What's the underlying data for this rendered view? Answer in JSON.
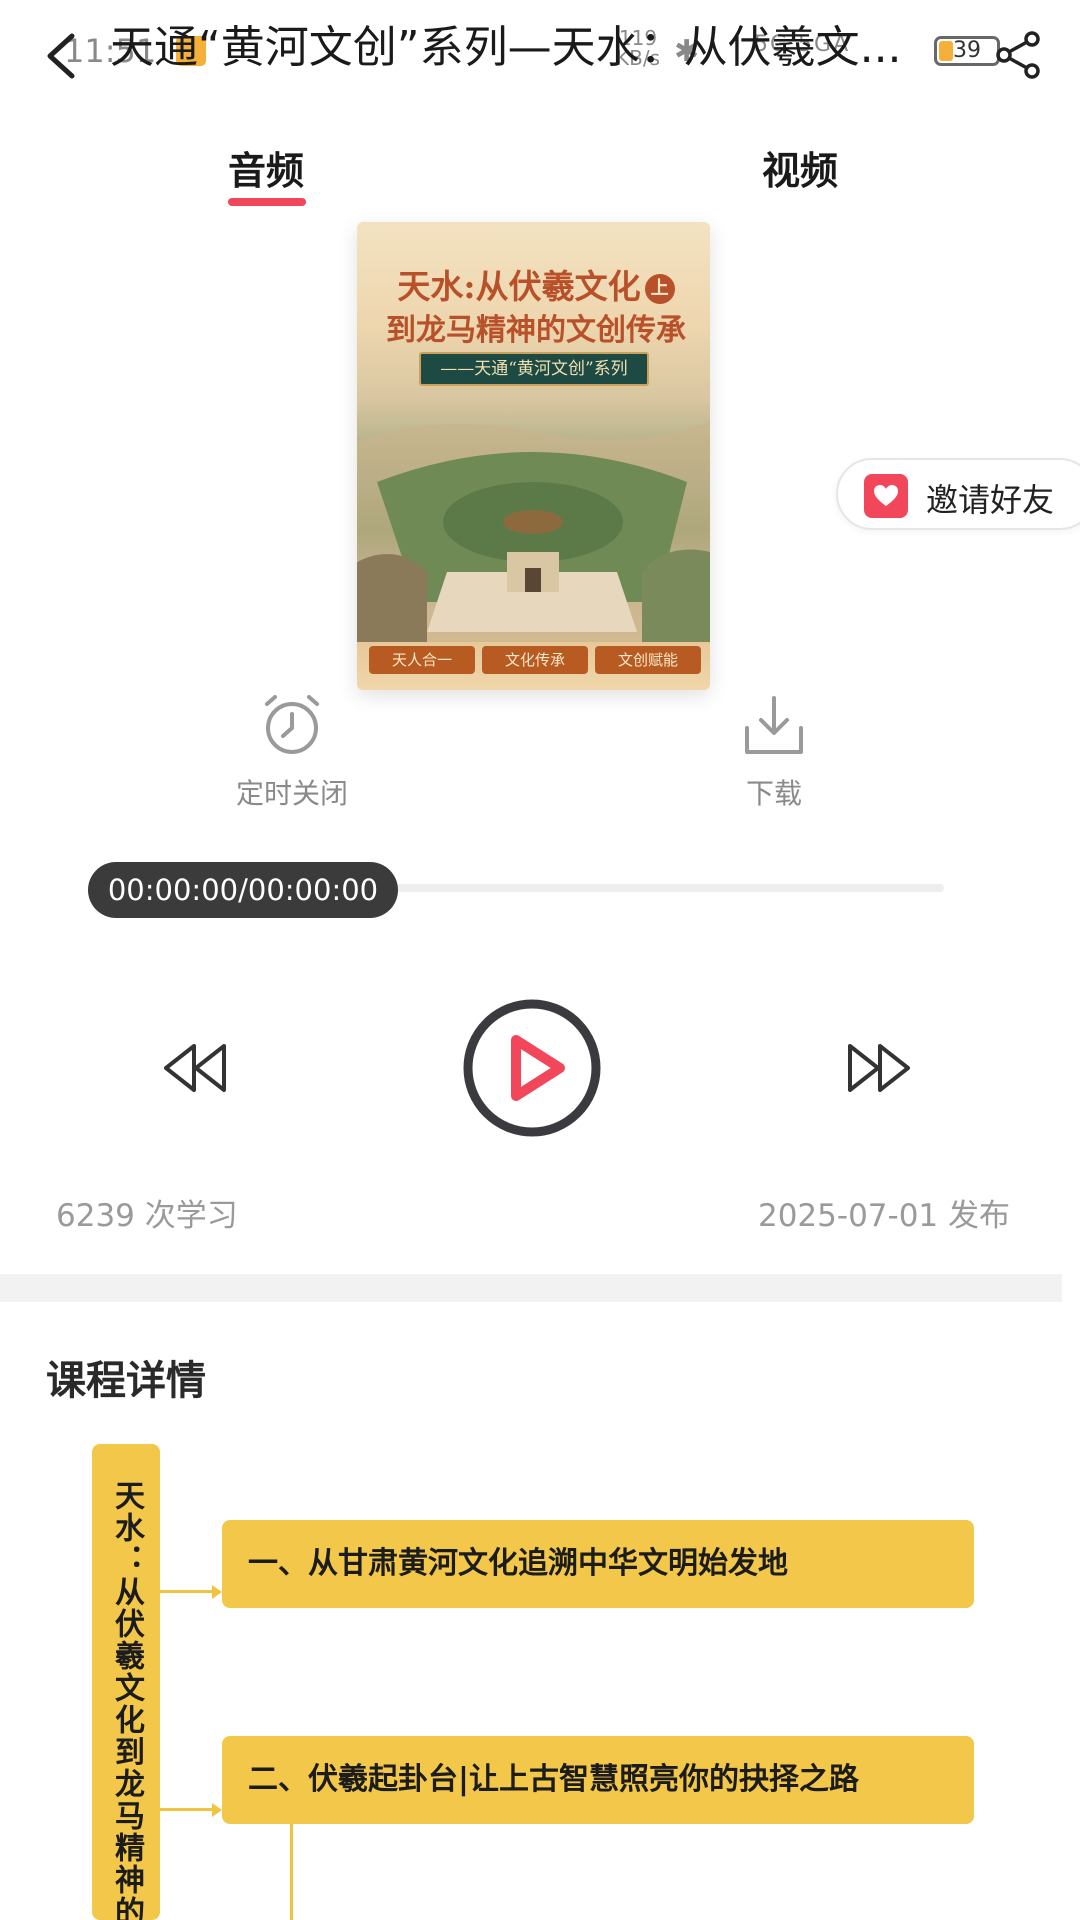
{
  "status_bar": {
    "time": "11:51",
    "net_speed": "119\nKB/s",
    "network": "5G 5GA",
    "battery": "39"
  },
  "header": {
    "title": "天通“黄河文创”系列—天水：从伏羲文..."
  },
  "tabs": [
    {
      "label": "音频",
      "active": true
    },
    {
      "label": "视频",
      "active": false
    }
  ],
  "cover": {
    "title_line1": "天水:从伏羲文化",
    "title_mark": "上",
    "title_line2": "到龙马精神的文创传承",
    "subtitle": "——天通“黄河文创”系列",
    "tags": [
      "天人合一",
      "文化传承",
      "文创赋能"
    ]
  },
  "invite": {
    "label": "邀请好友"
  },
  "tools": {
    "timer_label": "定时关闭",
    "download_label": "下载"
  },
  "player": {
    "time_display": "00:00:00/00:00:00",
    "progress": 0
  },
  "stats": {
    "views": "6239 次学习",
    "published": "2025-07-01 发布"
  },
  "details": {
    "section_title": "课程详情",
    "mindmap": {
      "root": "天水：从伏羲文化到龙马精神的文",
      "nodes": [
        "一、从甘肃黄河文化追溯中华文明始发地",
        "二、伏羲起卦台|让上古智慧照亮你的抉择之路"
      ]
    }
  },
  "colors": {
    "accent": "#f2465a",
    "mindmap_fill": "#f3c84a",
    "pill_bg": "#3b3b3b"
  },
  "icons": {
    "back": "chevron-left-icon",
    "share": "share-icon",
    "timer": "alarm-clock-icon",
    "download": "download-icon",
    "rewind": "rewind-icon",
    "play": "play-icon",
    "forward": "fast-forward-icon",
    "invite": "heart-envelope-icon"
  }
}
